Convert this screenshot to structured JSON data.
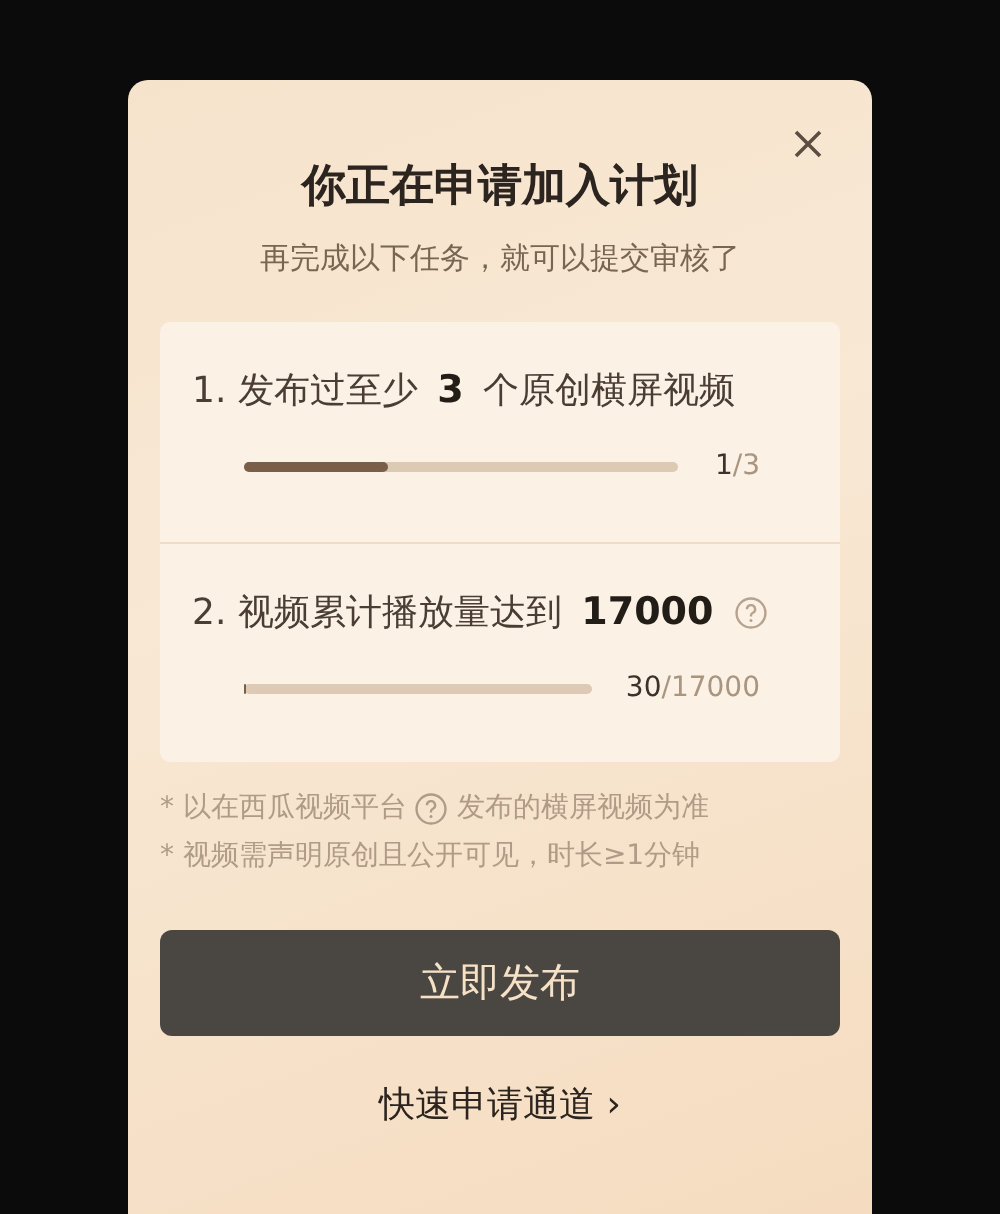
{
  "dialog": {
    "title": "你正在申请加入计划",
    "subtitle": "再完成以下任务，就可以提交审核了"
  },
  "tasks": [
    {
      "text": "1. 发布过至少 **3** 个原创横屏视频",
      "help": false,
      "level": 0.33,
      "current": "1",
      "total": "/3"
    },
    {
      "text": "2. 视频累计播放量达到 **17000**",
      "help": true,
      "level": 0.0018,
      "current": "30",
      "total": "/17000"
    }
  ],
  "notes": [
    {
      "before": "* 以在西瓜视频平台",
      "help": true,
      "after": "发布的横屏视频为准"
    },
    {
      "before": "* 视频需声明原创且公开可见，时长≥1分钟",
      "help": false
    }
  ],
  "primary_button": "立即发布",
  "link": {
    "label": "快速申请通道",
    "chevron": "›"
  }
}
